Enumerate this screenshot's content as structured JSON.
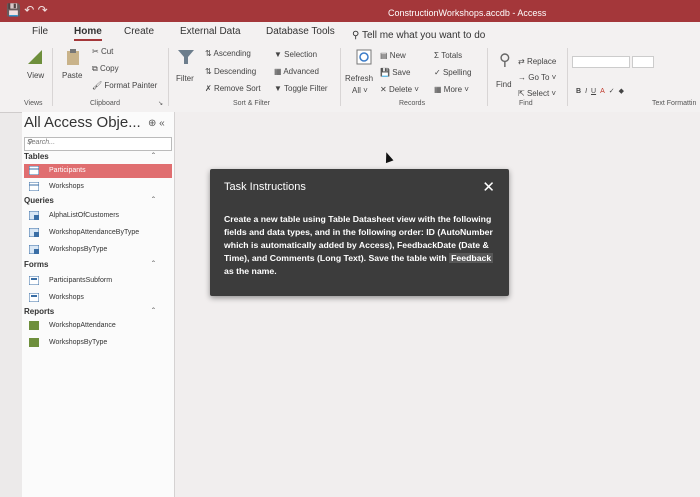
{
  "window": {
    "title": "ConstructionWorkshops.accdb - Access"
  },
  "tabs": [
    "File",
    "Home",
    "Create",
    "External Data",
    "Database Tools"
  ],
  "tell_me": "Tell me what you want to do",
  "ribbon": {
    "views": {
      "view": "View",
      "group": "Views"
    },
    "clipboard": {
      "paste": "Paste",
      "cut": "Cut",
      "copy": "Copy",
      "format_painter": "Format Painter",
      "group": "Clipboard"
    },
    "sort_filter": {
      "filter": "Filter",
      "ascending": "Ascending",
      "descending": "Descending",
      "remove_sort": "Remove Sort",
      "selection": "Selection",
      "advanced": "Advanced",
      "toggle_filter": "Toggle Filter",
      "group": "Sort & Filter"
    },
    "records": {
      "refresh": "Refresh",
      "refresh_all": "All",
      "new": "New",
      "save": "Save",
      "delete": "Delete",
      "totals": "Totals",
      "spelling": "Spelling",
      "more": "More",
      "group": "Records"
    },
    "find": {
      "find": "Find",
      "replace": "Replace",
      "goto": "Go To",
      "select": "Select",
      "group": "Find"
    },
    "text_formatting": {
      "group": "Text Formattin"
    }
  },
  "nav": {
    "title": "All Access Obje...",
    "search_placeholder": "Search...",
    "sections": [
      {
        "label": "Tables",
        "items": [
          "Participants",
          "Workshops"
        ]
      },
      {
        "label": "Queries",
        "items": [
          "AlphaListOfCustomers",
          "WorkshopAttendanceByType",
          "WorkshopsByType"
        ]
      },
      {
        "label": "Forms",
        "items": [
          "ParticipantsSubform",
          "Workshops"
        ]
      },
      {
        "label": "Reports",
        "items": [
          "WorkshopAttendance",
          "WorkshopsByType"
        ]
      }
    ]
  },
  "task": {
    "heading": "Task Instructions",
    "body_1": "Create a new table using Table Datasheet view with the following fields and data types, and in the following order: ID (AutoNumber which is automatically added by Access), FeedbackDate (Date & Time), and Comments (Long Text). Save the table with",
    "highlight": "Feedback",
    "body_2": "as the name."
  },
  "colors": {
    "accent": "#a4373a",
    "selected_item": "#e06e70",
    "tooltip_bg": "#3c3c3c"
  }
}
